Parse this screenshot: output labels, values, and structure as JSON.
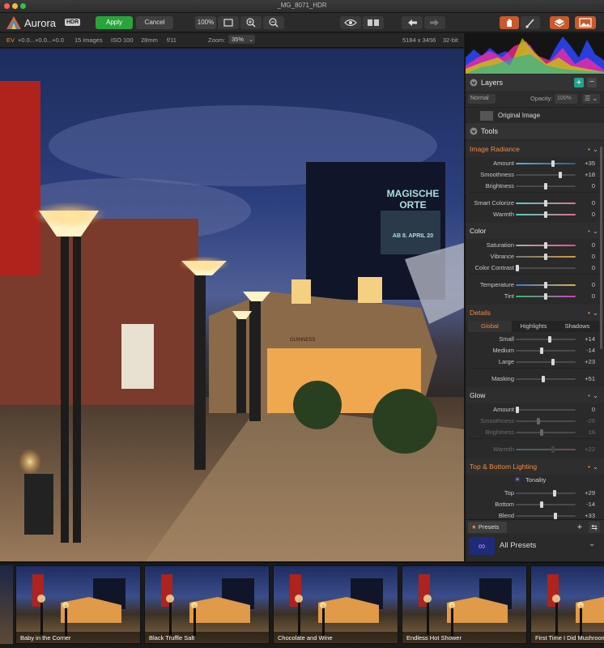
{
  "window": {
    "title": "_MG_8071_HDR"
  },
  "toolbar": {
    "app_name": "Aurora",
    "app_badge": "HDR",
    "apply_label": "Apply",
    "cancel_label": "Cancel",
    "zoom_label": "100%"
  },
  "infobar": {
    "ev_label": "EV",
    "ev_values": "+0.0...+0.0...+0.0",
    "images": "15 images",
    "iso": "ISO 100",
    "focal": "28mm",
    "aperture": "f/11",
    "zoom_label": "Zoom:",
    "zoom_value": "35%",
    "dimensions": "5184 x 3456",
    "bit_depth": "32-bit"
  },
  "photo_text": {
    "sign_line1": "MAGISCHE",
    "sign_line2": "ORTE",
    "sign_line3": "AB 8. APRIL 20",
    "pub_sign": "GUINNESS"
  },
  "layers": {
    "title": "Layers",
    "blend_mode": "Normal",
    "opacity_label": "Opacity:",
    "opacity_value": "100%",
    "layer_name": "Original Image"
  },
  "tools": {
    "title": "Tools"
  },
  "image_radiance": {
    "title": "Image Radiance",
    "sliders": [
      {
        "label": "Amount",
        "value": "+35"
      },
      {
        "label": "Smoothness",
        "value": "+18"
      },
      {
        "label": "Brightness",
        "value": "0"
      },
      {
        "label": "Smart Colorize",
        "value": "0"
      },
      {
        "label": "Warmth",
        "value": "0"
      }
    ]
  },
  "color": {
    "title": "Color",
    "sliders": [
      {
        "label": "Saturation",
        "value": "0"
      },
      {
        "label": "Vibrance",
        "value": "0"
      },
      {
        "label": "Color Contrast",
        "value": "0"
      },
      {
        "label": "Temperature",
        "value": "0"
      },
      {
        "label": "Tint",
        "value": "0"
      }
    ]
  },
  "details": {
    "title": "Details",
    "tabs": [
      "Global",
      "Highlights",
      "Shadows"
    ],
    "sliders": [
      {
        "label": "Small",
        "value": "+14"
      },
      {
        "label": "Medium",
        "value": "-14"
      },
      {
        "label": "Large",
        "value": "+23"
      },
      {
        "label": "Masking",
        "value": "+51"
      }
    ]
  },
  "glow": {
    "title": "Glow",
    "sliders": [
      {
        "label": "Amount",
        "value": "0"
      },
      {
        "label": "Smoothness",
        "value": "-26"
      },
      {
        "label": "Brightness",
        "value": "16"
      },
      {
        "label": "Warmth",
        "value": "+22"
      }
    ]
  },
  "top_bottom": {
    "title": "Top & Bottom Lighting",
    "tonality_label": "Tonality",
    "sliders": [
      {
        "label": "Top",
        "value": "+29"
      },
      {
        "label": "Bottom",
        "value": "-14"
      },
      {
        "label": "Blend",
        "value": "+33"
      }
    ]
  },
  "presets": {
    "tab_label": "Presets",
    "category": "All Presets",
    "items": [
      "Baby in the Corner",
      "Black Truffle Salt",
      "Chocolate and Wine",
      "Endless Hot Shower",
      "First Time I Did Mushroom"
    ]
  },
  "colors": {
    "accent": "#f08a3c",
    "apply_green": "#29a33c",
    "add_teal": "#1fa58a"
  }
}
